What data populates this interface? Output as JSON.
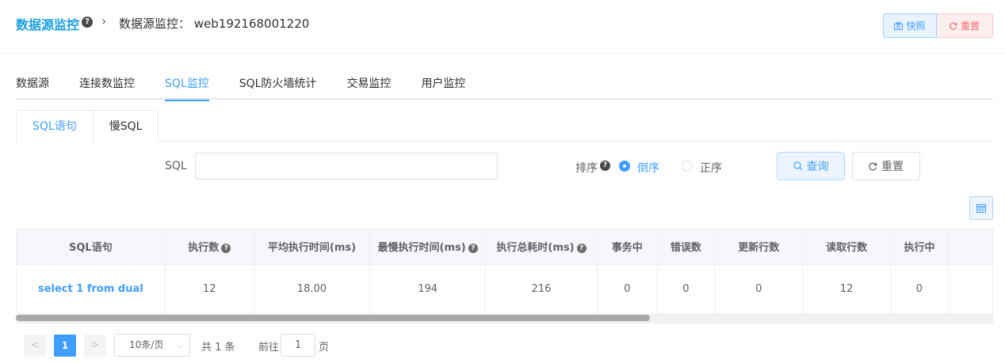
{
  "header": {
    "title": "数据源监控",
    "help": "?",
    "separator": ">",
    "path": "数据源监控： web192168001220",
    "snapshot_label": "快照",
    "reset_label": "重置"
  },
  "tabs": [
    "数据源",
    "连接数监控",
    "SQL监控",
    "SQL防火墙统计",
    "交易监控",
    "用户监控"
  ],
  "active_tab": "SQL监控",
  "sub_tabs": [
    "SQL语句",
    "慢SQL"
  ],
  "active_sub_tab": "SQL语句",
  "filter": {
    "sql_label": "SQL",
    "sql_value": "",
    "sort_label": "排序",
    "sort_help": "?",
    "sort_desc": "倒序",
    "sort_asc": "正序",
    "sort_selected": "倒序",
    "query_label": "查询",
    "reset_label": "重置"
  },
  "table": {
    "columns": [
      "SQL语句",
      "执行数",
      "平均执行时间(ms)",
      "最慢执行时间(ms)",
      "执行总耗时(ms)",
      "事务中",
      "错误数",
      "更新行数",
      "读取行数",
      "执行中"
    ],
    "rows": [
      [
        "select 1 from dual",
        "12",
        "18.00",
        "194",
        "216",
        "0",
        "0",
        "0",
        "12",
        "0"
      ]
    ]
  },
  "pagination": {
    "prev": "<",
    "current": "1",
    "next": ">",
    "page_size": "10条/页",
    "total": "共 1 条",
    "goto_label": "前往",
    "goto_value": "1",
    "page_label": "页"
  },
  "colors": {
    "accent": "#409eff",
    "title": "#1a9fe0",
    "danger": "#f56c6c"
  }
}
